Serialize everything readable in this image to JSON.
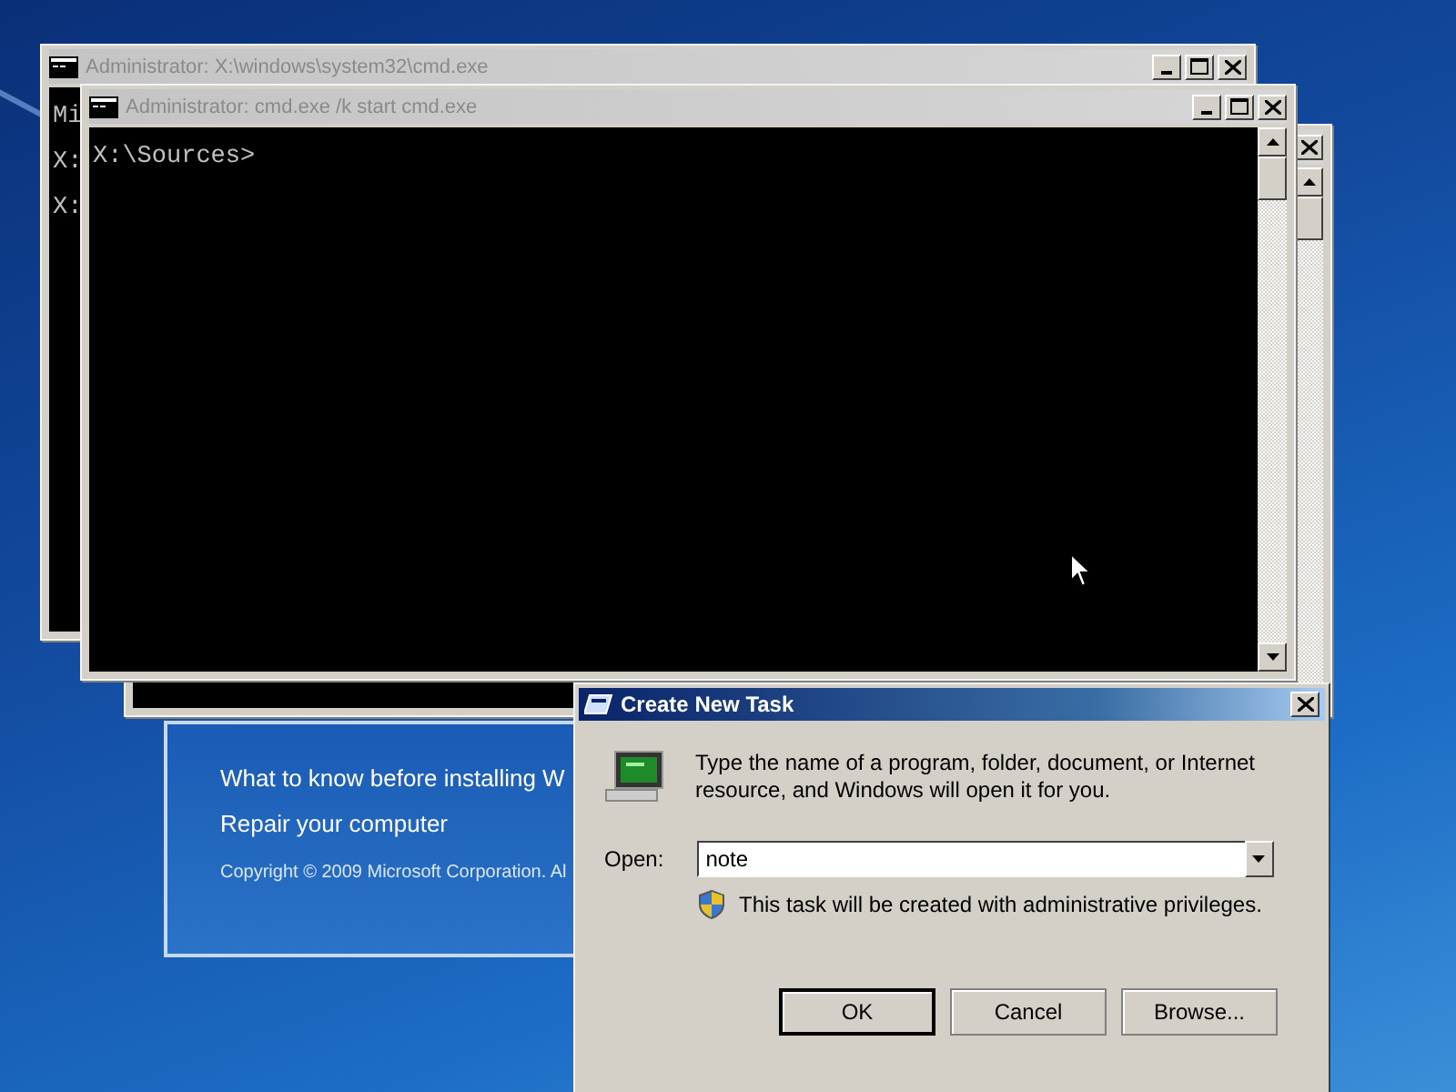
{
  "console_windows": [
    {
      "title": "Administrator: X:\\windows\\system32\\cmd.exe",
      "lines": [
        "Mi",
        "X:",
        "X:"
      ]
    },
    {
      "title": "Administrator: cmd.exe /k start cmd.exe",
      "lines": [
        "X:\\Sources>"
      ]
    }
  ],
  "setup_panel": {
    "links": [
      "What to know before installing W",
      "Repair your computer"
    ],
    "copyright": "Copyright © 2009 Microsoft Corporation. Al"
  },
  "dialog": {
    "title": "Create New Task",
    "description": "Type the name of a program, folder, document, or Internet resource, and Windows will open it for you.",
    "open_label": "Open:",
    "open_value": "note",
    "note": "This task will be created with administrative privileges.",
    "buttons": [
      {
        "label": "OK",
        "default": true
      },
      {
        "label": "Cancel",
        "default": false
      },
      {
        "label": "Browse...",
        "default": false
      }
    ]
  }
}
